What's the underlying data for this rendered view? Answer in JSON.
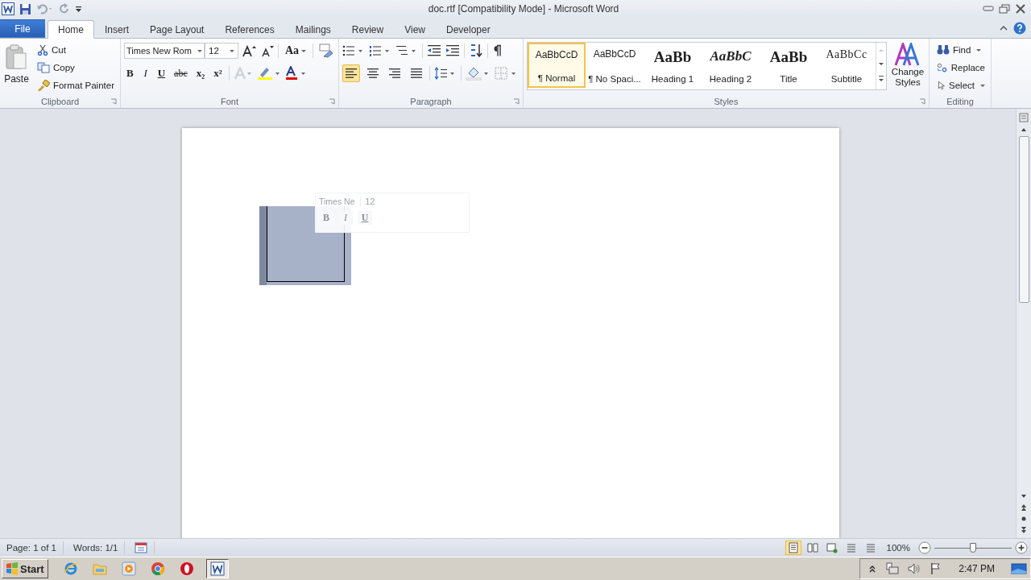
{
  "window": {
    "title": "doc.rtf [Compatibility Mode] -  Microsoft Word"
  },
  "tabs": [
    {
      "label": "File",
      "kind": "file",
      "selected": false
    },
    {
      "label": "Home",
      "kind": "tab",
      "selected": true
    },
    {
      "label": "Insert",
      "kind": "tab",
      "selected": false
    },
    {
      "label": "Page Layout",
      "kind": "tab",
      "selected": false
    },
    {
      "label": "References",
      "kind": "tab",
      "selected": false
    },
    {
      "label": "Mailings",
      "kind": "tab",
      "selected": false
    },
    {
      "label": "Review",
      "kind": "tab",
      "selected": false
    },
    {
      "label": "View",
      "kind": "tab",
      "selected": false
    },
    {
      "label": "Developer",
      "kind": "tab",
      "selected": false
    }
  ],
  "clipboard": {
    "label": "Clipboard",
    "paste": "Paste",
    "items": [
      "Cut",
      "Copy",
      "Format Painter"
    ]
  },
  "font": {
    "label": "Font",
    "family": "Times New Rom",
    "size": "12",
    "case_button": "Aa",
    "format_buttons": [
      "B",
      "I",
      "U",
      "abc",
      "x₂",
      "x²"
    ]
  },
  "paragraph": {
    "label": "Paragraph",
    "alignments": [
      {
        "selected": true
      },
      {
        "selected": false
      },
      {
        "selected": false
      },
      {
        "selected": false
      }
    ]
  },
  "styles": {
    "label": "Styles",
    "change_styles": "Change Styles",
    "items": [
      {
        "preview": "AaBbCcD",
        "name": "¶ Normal",
        "kind": "normal",
        "selected": true
      },
      {
        "preview": "AaBbCcD",
        "name": "¶ No Spaci...",
        "kind": "normal",
        "selected": false
      },
      {
        "preview": "AaBb",
        "name": "Heading 1",
        "kind": "heading1",
        "selected": false
      },
      {
        "preview": "AaBbC",
        "name": "Heading 2",
        "kind": "heading2",
        "selected": false
      },
      {
        "preview": "AaBb",
        "name": "Title",
        "kind": "title",
        "selected": false
      },
      {
        "preview": "AaBbCc",
        "name": "Subtitle",
        "kind": "subtitle",
        "selected": false
      }
    ]
  },
  "editing": {
    "label": "Editing",
    "items": [
      "Find",
      "Replace",
      "Select"
    ]
  },
  "mini_toolbar": {
    "font": "Times Ne",
    "size": "12",
    "format_buttons": [
      "B",
      "I",
      "U"
    ]
  },
  "status_bar": {
    "page": "Page: 1 of 1",
    "words": "Words: 1/1",
    "views": [
      {
        "selected": true
      },
      {
        "selected": false
      },
      {
        "selected": false
      },
      {
        "selected": false
      },
      {
        "selected": false
      }
    ],
    "zoom": "100%",
    "zoom_slider": {
      "level": 0.5
    }
  },
  "taskbar": {
    "start": "Start",
    "apps": [
      {
        "kind": "ie",
        "selected": false
      },
      {
        "kind": "folder",
        "selected": false
      },
      {
        "kind": "media",
        "selected": false
      },
      {
        "kind": "chrome",
        "selected": false
      },
      {
        "kind": "opera",
        "selected": false
      },
      {
        "kind": "word",
        "selected": true
      }
    ],
    "clock": "2:47 PM"
  }
}
